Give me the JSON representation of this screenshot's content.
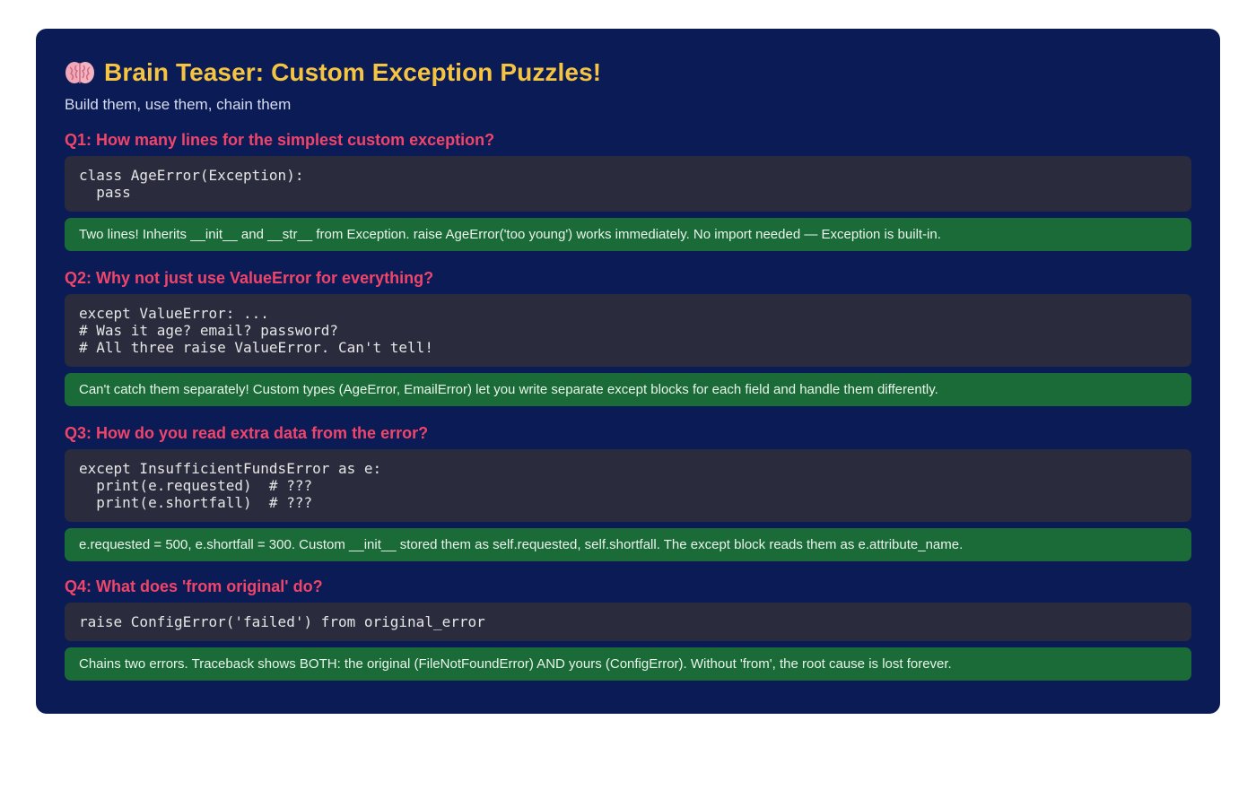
{
  "header": {
    "title": "Brain Teaser: Custom Exception Puzzles!",
    "subtitle": "Build them, use them, chain them",
    "icon": "brain-icon"
  },
  "colors": {
    "card_bg": "#0b1b56",
    "title": "#f5c542",
    "question": "#f0456a",
    "code_bg": "#2a2b3d",
    "answer_bg": "#1a6b37"
  },
  "questions": [
    {
      "question": "Q1: How many lines for the simplest custom exception?",
      "code": [
        "class AgeError(Exception):",
        "  pass"
      ],
      "answer": "Two lines! Inherits __init__ and __str__ from Exception. raise AgeError('too young') works immediately. No import needed — Exception is built-in."
    },
    {
      "question": "Q2: Why not just use ValueError for everything?",
      "code": [
        "except ValueError: ...",
        "# Was it age? email? password?",
        "# All three raise ValueError. Can't tell!"
      ],
      "answer": "Can't catch them separately! Custom types (AgeError, EmailError) let you write separate except blocks for each field and handle them differently."
    },
    {
      "question": "Q3: How do you read extra data from the error?",
      "code": [
        "except InsufficientFundsError as e:",
        "  print(e.requested)  # ???",
        "  print(e.shortfall)  # ???"
      ],
      "answer": "e.requested = 500, e.shortfall = 300. Custom __init__ stored them as self.requested, self.shortfall. The except block reads them as e.attribute_name."
    },
    {
      "question": "Q4: What does 'from original' do?",
      "code": [
        "raise ConfigError('failed') from original_error"
      ],
      "answer": "Chains two errors. Traceback shows BOTH: the original (FileNotFoundError) AND yours (ConfigError). Without 'from', the root cause is lost forever."
    }
  ]
}
